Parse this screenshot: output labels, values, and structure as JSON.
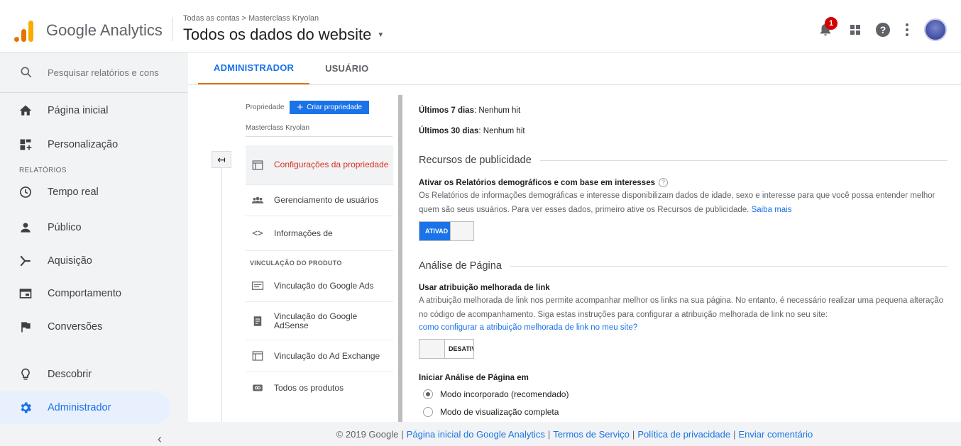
{
  "header": {
    "app_title": "Google Analytics",
    "breadcrumb": "Todas as contas > Masterclass Kryolan",
    "view_title": "Todos os dados do website",
    "notification_count": "1"
  },
  "sidebar": {
    "search_placeholder": "Pesquisar relatórios e cons",
    "items": [
      {
        "label": "Página inicial",
        "icon": "home-icon"
      },
      {
        "label": "Personalização",
        "icon": "dashboard-icon"
      },
      {
        "label": "Tempo real",
        "icon": "clock-icon"
      },
      {
        "label": "Público",
        "icon": "person-icon"
      },
      {
        "label": "Aquisição",
        "icon": "acquisition-icon"
      },
      {
        "label": "Comportamento",
        "icon": "behavior-icon"
      },
      {
        "label": "Conversões",
        "icon": "flag-icon"
      },
      {
        "label": "Descobrir",
        "icon": "lightbulb-icon"
      },
      {
        "label": "Administrador",
        "icon": "gear-icon"
      }
    ],
    "section_reports": "RELATÓRIOS"
  },
  "tabs": [
    {
      "label": "ADMINISTRADOR",
      "active": true
    },
    {
      "label": "USUÁRIO",
      "active": false
    }
  ],
  "property_column": {
    "label": "Propriedade",
    "create_button": "Criar propriedade",
    "property_name": "Masterclass Kryolan",
    "items": [
      {
        "label": "Configurações da propriedade",
        "icon": "settings-window-icon",
        "active": true
      },
      {
        "label": "Gerenciamento de usuários",
        "icon": "users-icon"
      },
      {
        "label": "Informações de",
        "icon": "code-icon"
      }
    ],
    "section_product": "VINCULAÇÃO DO PRODUTO",
    "product_items": [
      {
        "label": "Vinculação do Google Ads",
        "icon": "ads-icon"
      },
      {
        "label": "Vinculação do Google AdSense",
        "icon": "adsense-icon"
      },
      {
        "label": "Vinculação do Ad Exchange",
        "icon": "ad-exchange-icon"
      },
      {
        "label": "Todos os produtos",
        "icon": "link-icon"
      }
    ]
  },
  "content": {
    "last7_label": "Últimos 7 dias",
    "last7_value": ": Nenhum hit",
    "last30_label": "Últimos 30 dias",
    "last30_value": ": Nenhum hit",
    "ads_section_title": "Recursos de publicidade",
    "demographics_title": "Ativar os Relatórios demográficos e com base em interesses",
    "demographics_desc": "Os Relatórios de informações demográficas e interesse disponibilizam dados de idade, sexo e interesse para que você possa entender melhor quem são seus usuários. Para ver esses dados, primeiro ative os Recursos de publicidade.",
    "learn_more": "Saiba mais",
    "toggle_on_label": "ATIVAD",
    "page_analysis_title": "Análise de Página",
    "link_attr_title": "Usar atribuição melhorada de link",
    "link_attr_desc": "A atribuição melhorada de link nos permite acompanhar melhor os links na sua página. No entanto, é necessário realizar uma pequena alteração no código de acompanhamento. Siga estas instruções para configurar a atribuição melhorada de link no seu site:",
    "link_attr_link": "como configurar a atribuição melhorada de link no meu site?",
    "toggle_off_label": "DESATIV",
    "start_analysis_title": "Iniciar Análise de Página em",
    "radio_options": [
      {
        "label": "Modo incorporado (recomendado)",
        "checked": true
      },
      {
        "label": "Modo de visualização completa",
        "checked": false
      }
    ]
  },
  "footer": {
    "copyright": "© 2019 Google",
    "links": [
      "Página inicial do Google Analytics",
      "Termos de Serviço",
      "Política de privacidade",
      "Enviar comentário"
    ]
  },
  "colors": {
    "accent_blue": "#1a73e8",
    "accent_orange": "#e37400",
    "active_red": "#d93025",
    "badge_red": "#d50000"
  }
}
